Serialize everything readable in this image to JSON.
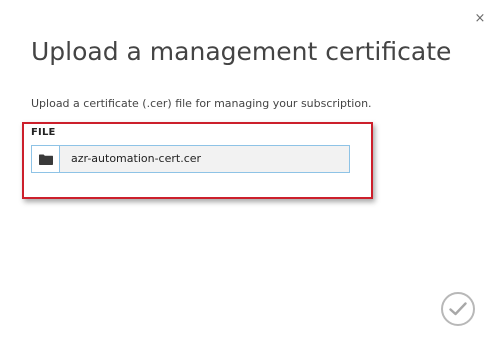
{
  "dialog": {
    "title": "Upload a management certificate",
    "description": "Upload a certificate (.cer) file for managing your subscription.",
    "close_label": "×"
  },
  "file_field": {
    "label": "FILE",
    "value": "azr-automation-cert.cer",
    "browse_icon": "folder-icon"
  },
  "actions": {
    "confirm_icon": "checkmark-icon"
  },
  "colors": {
    "highlight_border": "#cc1f2b",
    "input_border": "#8ec3e6",
    "input_background": "#f2f2f2",
    "confirm_circle": "#b8b8b8"
  }
}
